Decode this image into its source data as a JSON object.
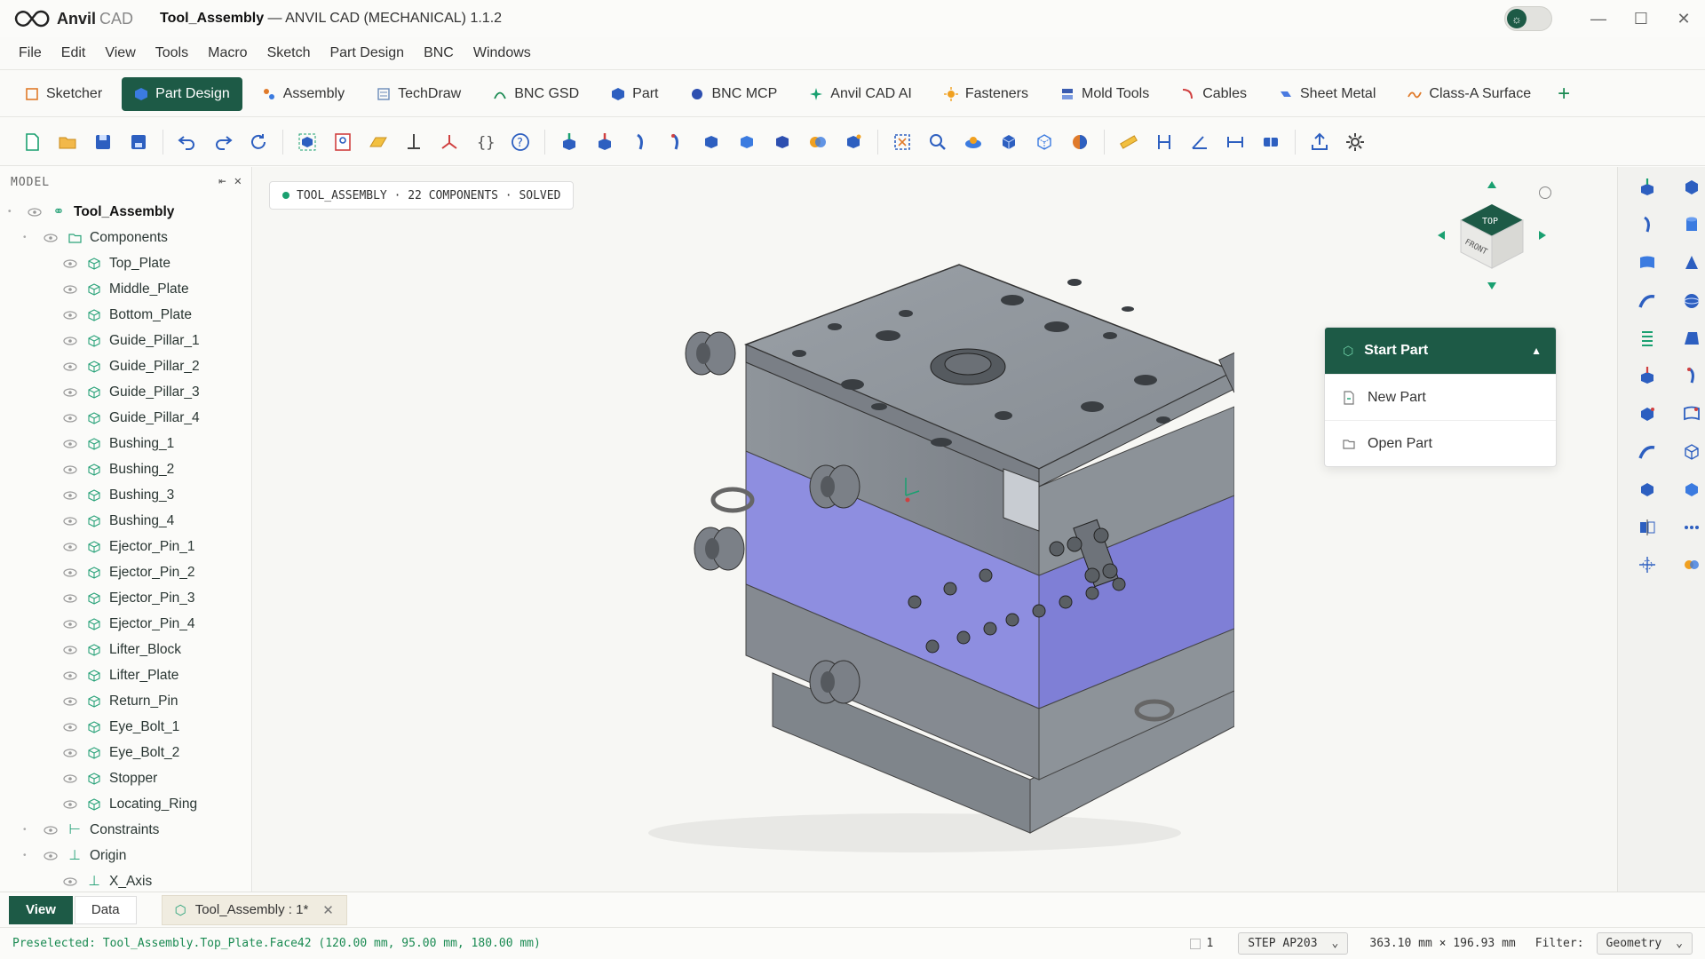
{
  "app": {
    "name": "Anvil",
    "name_suffix": "CAD",
    "doc_title": "Tool_Assembly",
    "title_rest": " — ANVIL CAD (MECHANICAL) 1.1.2"
  },
  "colors": {
    "accent": "#1d5a46",
    "success": "#1aa070",
    "highlight_purple": "#8e8ee0"
  },
  "menu": [
    "File",
    "Edit",
    "View",
    "Tools",
    "Macro",
    "Sketch",
    "Part Design",
    "BNC",
    "Windows"
  ],
  "workbenches": [
    {
      "label": "Sketcher",
      "icon": "sketcher-icon"
    },
    {
      "label": "Part Design",
      "icon": "part-design-icon",
      "active": true
    },
    {
      "label": "Assembly",
      "icon": "assembly-icon"
    },
    {
      "label": "TechDraw",
      "icon": "techdraw-icon"
    },
    {
      "label": "BNC GSD",
      "icon": "curve-icon"
    },
    {
      "label": "Part",
      "icon": "cube-icon"
    },
    {
      "label": "BNC MCP",
      "icon": "circle-icon"
    },
    {
      "label": "Anvil CAD AI",
      "icon": "sparkle-icon"
    },
    {
      "label": "Fasteners",
      "icon": "sun-icon"
    },
    {
      "label": "Mold Tools",
      "icon": "mold-icon"
    },
    {
      "label": "Cables",
      "icon": "cable-icon"
    },
    {
      "label": "Sheet Metal",
      "icon": "sheet-metal-icon"
    },
    {
      "label": "Class-A Surface",
      "icon": "surface-icon"
    }
  ],
  "model_panel": {
    "title": "MODEL",
    "root": "Tool_Assembly",
    "components_label": "Components",
    "components": [
      "Top_Plate",
      "Middle_Plate",
      "Bottom_Plate",
      "Guide_Pillar_1",
      "Guide_Pillar_2",
      "Guide_Pillar_3",
      "Guide_Pillar_4",
      "Bushing_1",
      "Bushing_2",
      "Bushing_3",
      "Bushing_4",
      "Ejector_Pin_1",
      "Ejector_Pin_2",
      "Ejector_Pin_3",
      "Ejector_Pin_4",
      "Lifter_Block",
      "Lifter_Plate",
      "Return_Pin",
      "Eye_Bolt_1",
      "Eye_Bolt_2",
      "Stopper",
      "Locating_Ring"
    ],
    "constraints_label": "Constraints",
    "origin_label": "Origin",
    "x_axis_label": "X_Axis"
  },
  "viewport": {
    "status": "TOOL_ASSEMBLY · 22 COMPONENTS · SOLVED",
    "navcube_top": "TOP",
    "navcube_front": "FRONT"
  },
  "start_part": {
    "title": "Start Part",
    "items": [
      "New Part",
      "Open Part"
    ]
  },
  "bottom_tabs": {
    "view": "View",
    "data": "Data",
    "document": "Tool_Assembly : 1*"
  },
  "statusbar": {
    "preselected": "Preselected: Tool_Assembly.Top_Plate.Face42 (120.00 mm, 95.00 mm, 180.00 mm)",
    "count": "1",
    "format": "STEP AP203",
    "dims": "363.10 mm × 196.93 mm",
    "filter_label": "Filter:",
    "filter_value": "Geometry"
  }
}
